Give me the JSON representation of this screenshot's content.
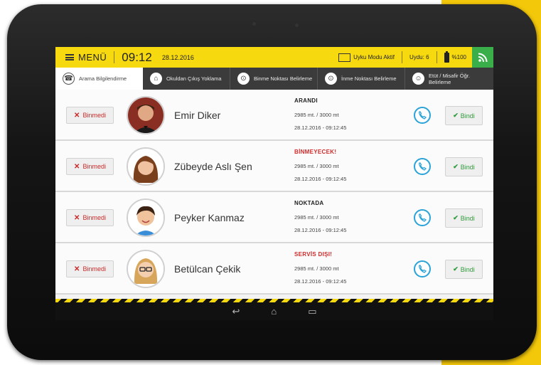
{
  "statusbar": {
    "menu_label": "MENÜ",
    "clock": "09:12",
    "date": "28.12.2016",
    "sleep_mode": "Uyku Modu Aktif",
    "satellite": "Uydu: 6",
    "battery": "%100"
  },
  "tabs": [
    {
      "label": "Arama Bilgilendirme",
      "icon": "phone-contact-icon"
    },
    {
      "label": "Okuldan Çıkış Yoklama",
      "icon": "school-icon"
    },
    {
      "label": "Binme Noktası Belirleme",
      "icon": "pin-icon"
    },
    {
      "label": "İnme Noktası Belirleme",
      "icon": "pin-icon"
    },
    {
      "label": "Etüt / Misafir Öğr. Belirleme",
      "icon": "users-icon"
    }
  ],
  "students": [
    {
      "name": "Emir Diker",
      "status": "ARANDI",
      "status_color": "#222222",
      "distance": "2985 mt. / 3000 mt",
      "time": "28.12.2016 - 09:12:45",
      "miss_label": "Binmedi",
      "board_label": "Bindi"
    },
    {
      "name": "Zübeyde Aslı Şen",
      "status": "BİNMEYECEK!",
      "status_color": "#d42a2a",
      "distance": "2985 mt. / 3000 mt",
      "time": "28.12.2016 - 09:12:45",
      "miss_label": "Binmedi",
      "board_label": "Bindi"
    },
    {
      "name": "Peyker Kanmaz",
      "status": "NOKTADA",
      "status_color": "#222222",
      "distance": "2985 mt. / 3000 mt",
      "time": "28.12.2016 - 09:12:45",
      "miss_label": "Binmedi",
      "board_label": "Bindi"
    },
    {
      "name": "Betülcan Çekik",
      "status": "SERVİS DIŞI!",
      "status_color": "#d42a2a",
      "distance": "2985 mt. / 3000 mt",
      "time": "28.12.2016 - 09:12:45",
      "miss_label": "Binmedi",
      "board_label": "Bindi"
    }
  ],
  "colors": {
    "accent_yellow": "#f6d90f",
    "tab_dark": "#3b3b3b",
    "call_blue": "#2aa3d8",
    "ok_green": "#2f9a3a",
    "miss_red": "#cc2a2a"
  }
}
